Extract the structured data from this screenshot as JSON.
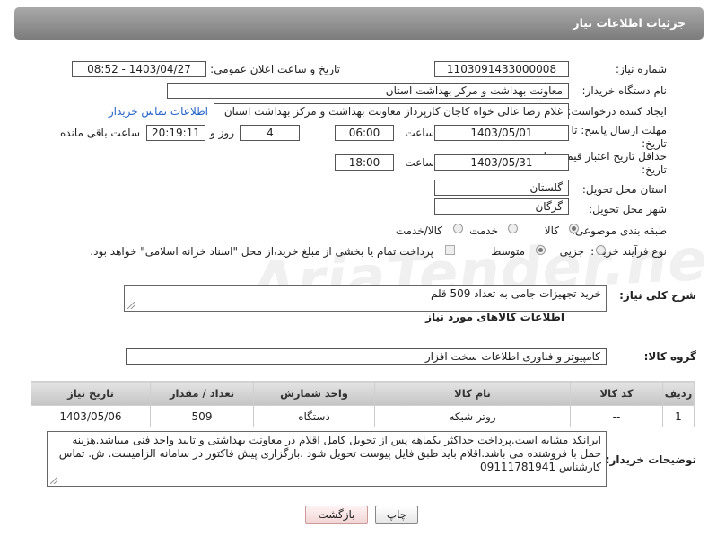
{
  "header": {
    "title": "جزئیات اطلاعات نیاز"
  },
  "fields": {
    "need_number_label": "شماره نیاز:",
    "need_number": "1103091433000008",
    "announce_label": "تاریخ و ساعت اعلان عمومی:",
    "announce_value": "1403/04/27 - 08:52",
    "buyer_org_label": "نام دستگاه خریدار:",
    "buyer_org": "معاونت  بهداشت و مرکز بهداشت استان",
    "creator_label": "ایجاد کننده درخواست:",
    "creator": "غلام رضا عالی خواه کاجان کارپرداز معاونت  بهداشت و مرکز بهداشت استان",
    "contact_link": "اطلاعات تماس خریدار",
    "reply_deadline_label_1": "مهلت ارسال پاسخ: تا",
    "reply_deadline_label_2": "تاریخ:",
    "reply_date": "1403/05/01",
    "time_label": "ساعت",
    "reply_time": "06:00",
    "days_value": "4",
    "days_label": "روز و",
    "remaining_time": "20:19:11",
    "remaining_label": "ساعت باقی مانده",
    "validity_label_1": "حداقل تاریخ اعتبار قیمت: تا",
    "validity_label_2": "تاریخ:",
    "validity_date": "1403/05/31",
    "validity_time": "18:00",
    "province_label": "استان محل تحویل:",
    "province": "گلستان",
    "city_label": "شهر محل تحویل:",
    "city": "گرگان",
    "category_label": "طبقه بندی موضوعی:",
    "category_options": [
      "کالا",
      "خدمت",
      "کالا/خدمت"
    ],
    "process_label": "نوع فرآیند خرید :",
    "process_options": [
      "جزیی",
      "متوسط"
    ],
    "payment_note": "پرداخت تمام یا بخشی از مبلغ خرید،از محل \"اسناد خزانه اسلامی\" خواهد بود.",
    "summary_label": "شرح کلی نیاز:",
    "summary": "خرید تجهیزات جامی به تعداد  509 قلم",
    "goods_info_title": "اطلاعات کالاهای مورد نیاز",
    "goods_group_label": "گروه کالا:",
    "goods_group": "کامپیوتر و فناوری اطلاعات-سخت افزار",
    "buyer_notes_label": "توضیحات خریدار:",
    "buyer_notes": "ایرانکد مشابه است.پرداخت حداکثر یکماهه پس از تحویل کامل اقلام در معاونت بهداشتی و تایید واحد فنی میباشد.هزینه حمل با فروشنده می باشد.اقلام باید طبق فایل پیوست تحویل شود .بارگزاری پیش فاکتور در سامانه الزامیست. ش. تماس کارشناس  09111781941"
  },
  "table": {
    "headers": [
      "ردیف",
      "کد کالا",
      "نام کالا",
      "واحد شمارش",
      "تعداد / مقدار",
      "تاریخ نیاز"
    ],
    "rows": [
      [
        "1",
        "--",
        "روتر شبکه",
        "دستگاه",
        "509",
        "1403/05/06"
      ]
    ]
  },
  "buttons": {
    "print": "چاپ",
    "back": "بازگشت"
  },
  "watermark": "AriaTender.neT"
}
